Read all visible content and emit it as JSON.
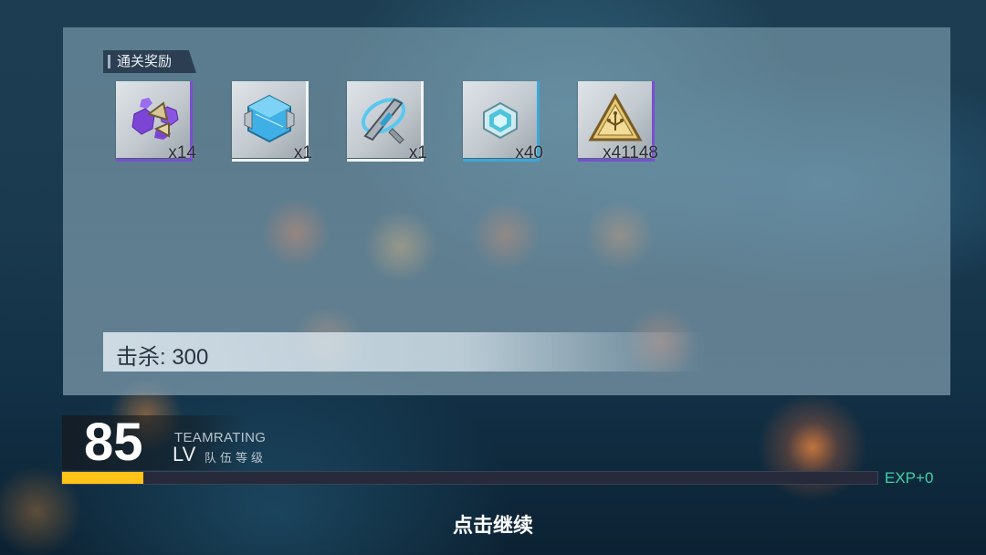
{
  "rewards_panel": {
    "title": "通关奖励",
    "items": [
      {
        "icon": "purple-hexagon-shards-icon",
        "quantity": "x14",
        "rarity_color": "#7a4fd0"
      },
      {
        "icon": "blue-cube-module-icon",
        "quantity": "x1",
        "rarity_color": "#f1f3f5"
      },
      {
        "icon": "blade-component-icon",
        "quantity": "x1",
        "rarity_color": "#f1f3f5"
      },
      {
        "icon": "teal-hexagon-chip-icon",
        "quantity": "x40",
        "rarity_color": "#3aa8d8"
      },
      {
        "icon": "gold-triangle-circuit-icon",
        "quantity": "x41148",
        "rarity_color": "#7a4fd0"
      }
    ],
    "kills_text": "击杀: 300"
  },
  "team": {
    "level": "85",
    "rating_label": "TEAMRATING",
    "lv_label": "LV",
    "level_label": "队伍等级",
    "exp_progress": 0.1,
    "exp_text": "EXP+0"
  },
  "continue_text": "点击继续",
  "colors": {
    "exp_fill": "#ffc417",
    "exp_text": "#3fd3a6",
    "purple_rarity": "#7a4fd0",
    "blue_rarity": "#3aa8d8"
  }
}
